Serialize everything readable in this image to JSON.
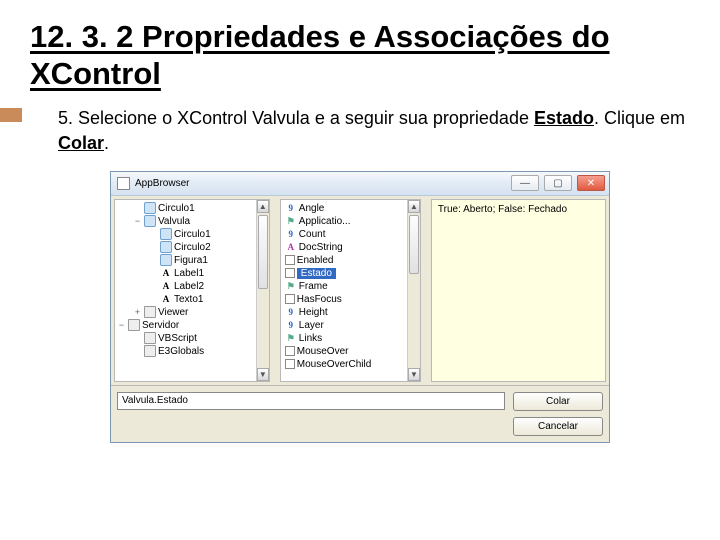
{
  "heading": "12. 3. 2 Propriedades e Associações do XControl",
  "instruction_prefix": "5. Selecione o XControl Valvula e a seguir sua propriedade ",
  "instruction_bold1": "Estado",
  "instruction_mid": ". Clique em ",
  "instruction_bold2": "Colar",
  "instruction_suffix": ".",
  "app": {
    "title": "AppBrowser",
    "tree": [
      {
        "icon": "obj",
        "label": "Circulo1",
        "indent": 1,
        "twisty": ""
      },
      {
        "icon": "obj",
        "label": "Valvula",
        "indent": 1,
        "twisty": "−",
        "sel": false
      },
      {
        "icon": "obj",
        "label": "Circulo1",
        "indent": 2,
        "twisty": ""
      },
      {
        "icon": "obj",
        "label": "Circulo2",
        "indent": 2,
        "twisty": ""
      },
      {
        "icon": "obj",
        "label": "Figura1",
        "indent": 2,
        "twisty": ""
      },
      {
        "icon": "A",
        "label": "Label1",
        "indent": 2,
        "twisty": ""
      },
      {
        "icon": "A",
        "label": "Label2",
        "indent": 2,
        "twisty": ""
      },
      {
        "icon": "A",
        "label": "Texto1",
        "indent": 2,
        "twisty": ""
      },
      {
        "icon": "comp",
        "label": "Viewer",
        "indent": 1,
        "twisty": "+"
      },
      {
        "icon": "comp",
        "label": "Servidor",
        "indent": 0,
        "twisty": "−"
      },
      {
        "icon": "comp",
        "label": "VBScript",
        "indent": 1,
        "twisty": ""
      },
      {
        "icon": "comp",
        "label": "E3Globals",
        "indent": 1,
        "twisty": ""
      }
    ],
    "props": [
      {
        "icon": "num",
        "label": "Angle"
      },
      {
        "icon": "prop",
        "label": "Applicatio..."
      },
      {
        "icon": "num",
        "label": "Count"
      },
      {
        "icon": "str",
        "label": "DocString"
      },
      {
        "icon": "bool",
        "label": "Enabled"
      },
      {
        "icon": "bool",
        "label": "Estado",
        "sel": true
      },
      {
        "icon": "prop",
        "label": "Frame"
      },
      {
        "icon": "bool",
        "label": "HasFocus"
      },
      {
        "icon": "num",
        "label": "Height"
      },
      {
        "icon": "num",
        "label": "Layer"
      },
      {
        "icon": "prop",
        "label": "Links"
      },
      {
        "icon": "bool",
        "label": "MouseOver"
      },
      {
        "icon": "bool",
        "label": "MouseOverChild"
      }
    ],
    "help_text": "True: Aberto; False: Fechado",
    "path_value": "Valvula.Estado",
    "btn_paste": "Colar",
    "btn_cancel": "Cancelar"
  }
}
